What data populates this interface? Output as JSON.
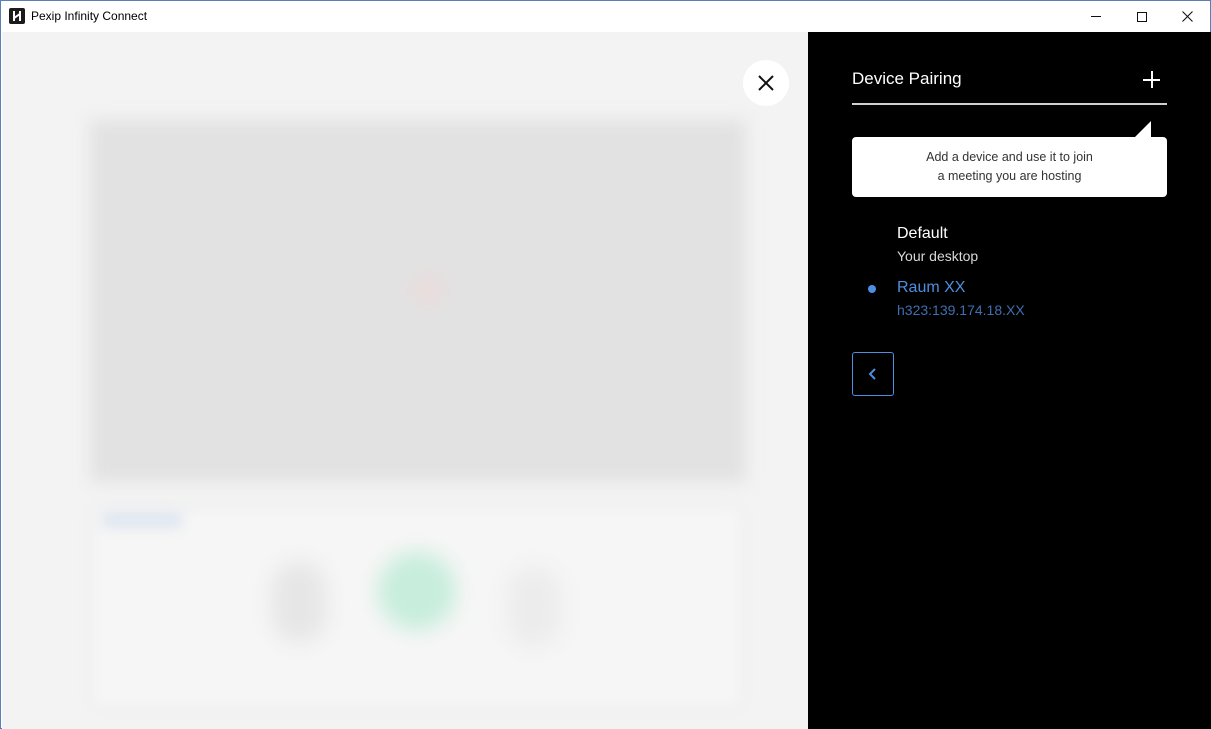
{
  "window": {
    "title": "Pexip Infinity Connect",
    "icon": "pexip-logo-icon"
  },
  "titlebar_controls": {
    "minimize": "minimize-icon",
    "maximize": "maximize-icon",
    "close": "close-icon"
  },
  "overlay": {
    "close_icon": "close-icon"
  },
  "device_pairing": {
    "title": "Device Pairing",
    "add_icon": "plus-icon",
    "tooltip_line1": "Add a device and use it to join",
    "tooltip_line2": "a meeting you are hosting",
    "devices": [
      {
        "name": "Default",
        "detail": "Your desktop",
        "selected": false
      },
      {
        "name": "Raum XX",
        "detail": "h323:139.174.18.XX",
        "selected": true
      }
    ],
    "back_icon": "chevron-left-icon"
  },
  "colors": {
    "accent": "#4d8fe0",
    "panel_bg": "#000000",
    "left_bg": "#f3f3f3"
  }
}
